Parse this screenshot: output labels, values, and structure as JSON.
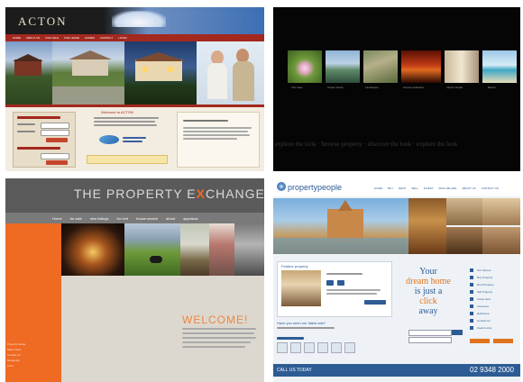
{
  "acton": {
    "logo": "ACTON",
    "nav": [
      "HOME",
      "ABOUT US",
      "FOR SALE",
      "FOR LEASE",
      "HOMES",
      "CONTACT",
      "LOGIN"
    ],
    "welcome_title": "Welcome to ACTON",
    "colors": {
      "header": "#1c1c1c",
      "nav": "#a3281e",
      "bg": "#f3ece0",
      "button": "#c4452c"
    }
  },
  "gallery": {
    "captions": [
      "The Lake",
      "Ocean Views",
      "Landscape",
      "Sunset Collection",
      "Interior Detail",
      "Beach"
    ],
    "footer_text": "explore the look · browse property · discover the look · explore the look"
  },
  "exchange": {
    "title_prefix": "THE PROPERTY E",
    "title_x": "X",
    "title_suffix": "CHANGE",
    "nav": [
      "Home",
      "for sale",
      "new listings",
      "for rent",
      "house search",
      "about",
      "appraisal"
    ],
    "welcome": "WELCOME!",
    "side_links": [
      "Property Guide",
      "Sales Team",
      "Contact Us",
      "Newsletter",
      "Links"
    ],
    "colors": {
      "orange": "#ef6a22",
      "header": "#5a5a5a",
      "welcome": "#ee8540"
    }
  },
  "property_people": {
    "logo": "propertypeople",
    "nav": [
      "HOME",
      "BUY",
      "RENT",
      "SELL",
      "INVEST",
      "WHO WE ARE",
      "ABOUT US",
      "CONTACT US"
    ],
    "featured_title": "Feature property",
    "tagline_line1": "Your",
    "tagline_line2": "dream home",
    "tagline_line3": "is just a",
    "tagline_line4": "click",
    "tagline_line5": "away",
    "newsletter": "Have you seen our latest ads?",
    "sidebar": [
      "Our Homes",
      "Buy Property",
      "Rent Property",
      "Sell Property",
      "Invest Here",
      "Insurance",
      "Refinance",
      "Contact Us",
      "Useful Links"
    ],
    "footer_left": "CALL US TODAY",
    "footer_right": "02 9348 2000",
    "colors": {
      "blue": "#2d5c94",
      "accent": "#e0741e"
    }
  }
}
